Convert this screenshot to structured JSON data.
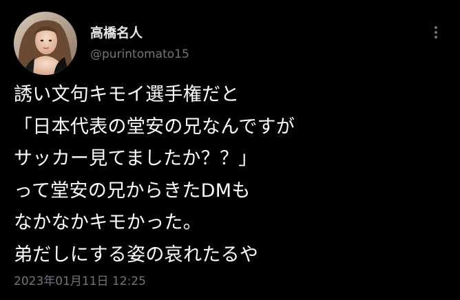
{
  "author": {
    "display_name": "高橋名人",
    "handle": "@purintomato15",
    "avatar_icon": "profile-photo"
  },
  "more_icon": "more-vertical-icon",
  "tweet": {
    "lines": [
      "誘い文句キモイ選手権だと",
      "「日本代表の堂安の兄なんですが",
      "サッカー見てましたか？？」",
      "って堂安の兄からきたDMも",
      "なかなかキモかった。",
      "弟だしにする姿の哀れたるや"
    ],
    "timestamp": "2023年01月11日 12:25"
  },
  "colors": {
    "background": "#000000",
    "primary_text": "#e7e9ea",
    "secondary_text": "#71767b"
  }
}
